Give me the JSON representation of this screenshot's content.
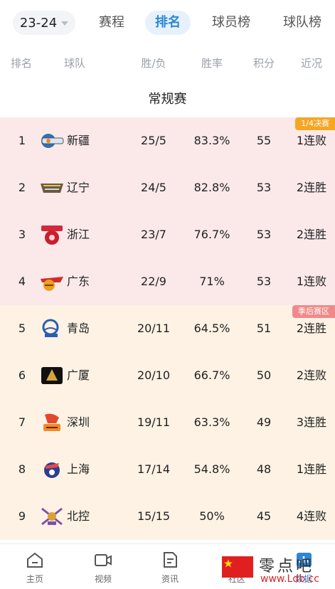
{
  "header": {
    "season": "23-24",
    "tabs": [
      {
        "label": "赛程",
        "active": false
      },
      {
        "label": "排名",
        "active": true
      },
      {
        "label": "球员榜",
        "active": false
      },
      {
        "label": "球队榜",
        "active": false
      }
    ]
  },
  "columns": {
    "rank": "排名",
    "team": "球队",
    "wl": "胜/负",
    "pct": "胜率",
    "pts": "积分",
    "form": "近况"
  },
  "section_title": "常规赛",
  "zones": [
    {
      "label": "1/4决赛",
      "color": "#f5a623",
      "bg": "#fbe9ea"
    },
    {
      "label": "季后赛区",
      "color": "#f08a8a",
      "bg": "#fdf2e4"
    }
  ],
  "teams": [
    {
      "rank": "1",
      "name": "新疆",
      "wl": "25/5",
      "pct": "83.3%",
      "pts": "55",
      "form": "1连败",
      "logo": "xinjiang-logo",
      "zone": 0
    },
    {
      "rank": "2",
      "name": "辽宁",
      "wl": "24/5",
      "pct": "82.8%",
      "pts": "53",
      "form": "2连胜",
      "logo": "liaoning-logo",
      "zone": 0
    },
    {
      "rank": "3",
      "name": "浙江",
      "wl": "23/7",
      "pct": "76.7%",
      "pts": "53",
      "form": "2连胜",
      "logo": "zhejiang-logo",
      "zone": 0
    },
    {
      "rank": "4",
      "name": "广东",
      "wl": "22/9",
      "pct": "71%",
      "pts": "53",
      "form": "1连败",
      "logo": "guangdong-logo",
      "zone": 0
    },
    {
      "rank": "5",
      "name": "青岛",
      "wl": "20/11",
      "pct": "64.5%",
      "pts": "51",
      "form": "2连胜",
      "logo": "qingdao-logo",
      "zone": 1
    },
    {
      "rank": "6",
      "name": "广厦",
      "wl": "20/10",
      "pct": "66.7%",
      "pts": "50",
      "form": "2连败",
      "logo": "guangsha-logo",
      "zone": 1
    },
    {
      "rank": "7",
      "name": "深圳",
      "wl": "19/11",
      "pct": "63.3%",
      "pts": "49",
      "form": "3连胜",
      "logo": "shenzhen-logo",
      "zone": 1
    },
    {
      "rank": "8",
      "name": "上海",
      "wl": "17/14",
      "pct": "54.8%",
      "pts": "48",
      "form": "1连胜",
      "logo": "shanghai-logo",
      "zone": 1
    },
    {
      "rank": "9",
      "name": "北控",
      "wl": "15/15",
      "pct": "50%",
      "pts": "45",
      "form": "4连败",
      "logo": "beikong-logo",
      "zone": 1
    }
  ],
  "nav": [
    {
      "label": "主页",
      "icon": "home-icon",
      "active": false
    },
    {
      "label": "视频",
      "icon": "video-icon",
      "active": false
    },
    {
      "label": "资讯",
      "icon": "news-icon",
      "active": false
    },
    {
      "label": "社区",
      "icon": "community-icon",
      "active": false
    },
    {
      "label": "数据",
      "icon": "data-icon",
      "active": true
    }
  ],
  "watermark": {
    "line1": "零点吧",
    "line2": "www.Ldb.cc"
  },
  "colors": {
    "accent": "#2a88d8",
    "zone1_bg": "#fbe9ea",
    "zone2_bg": "#fdf2e4"
  }
}
